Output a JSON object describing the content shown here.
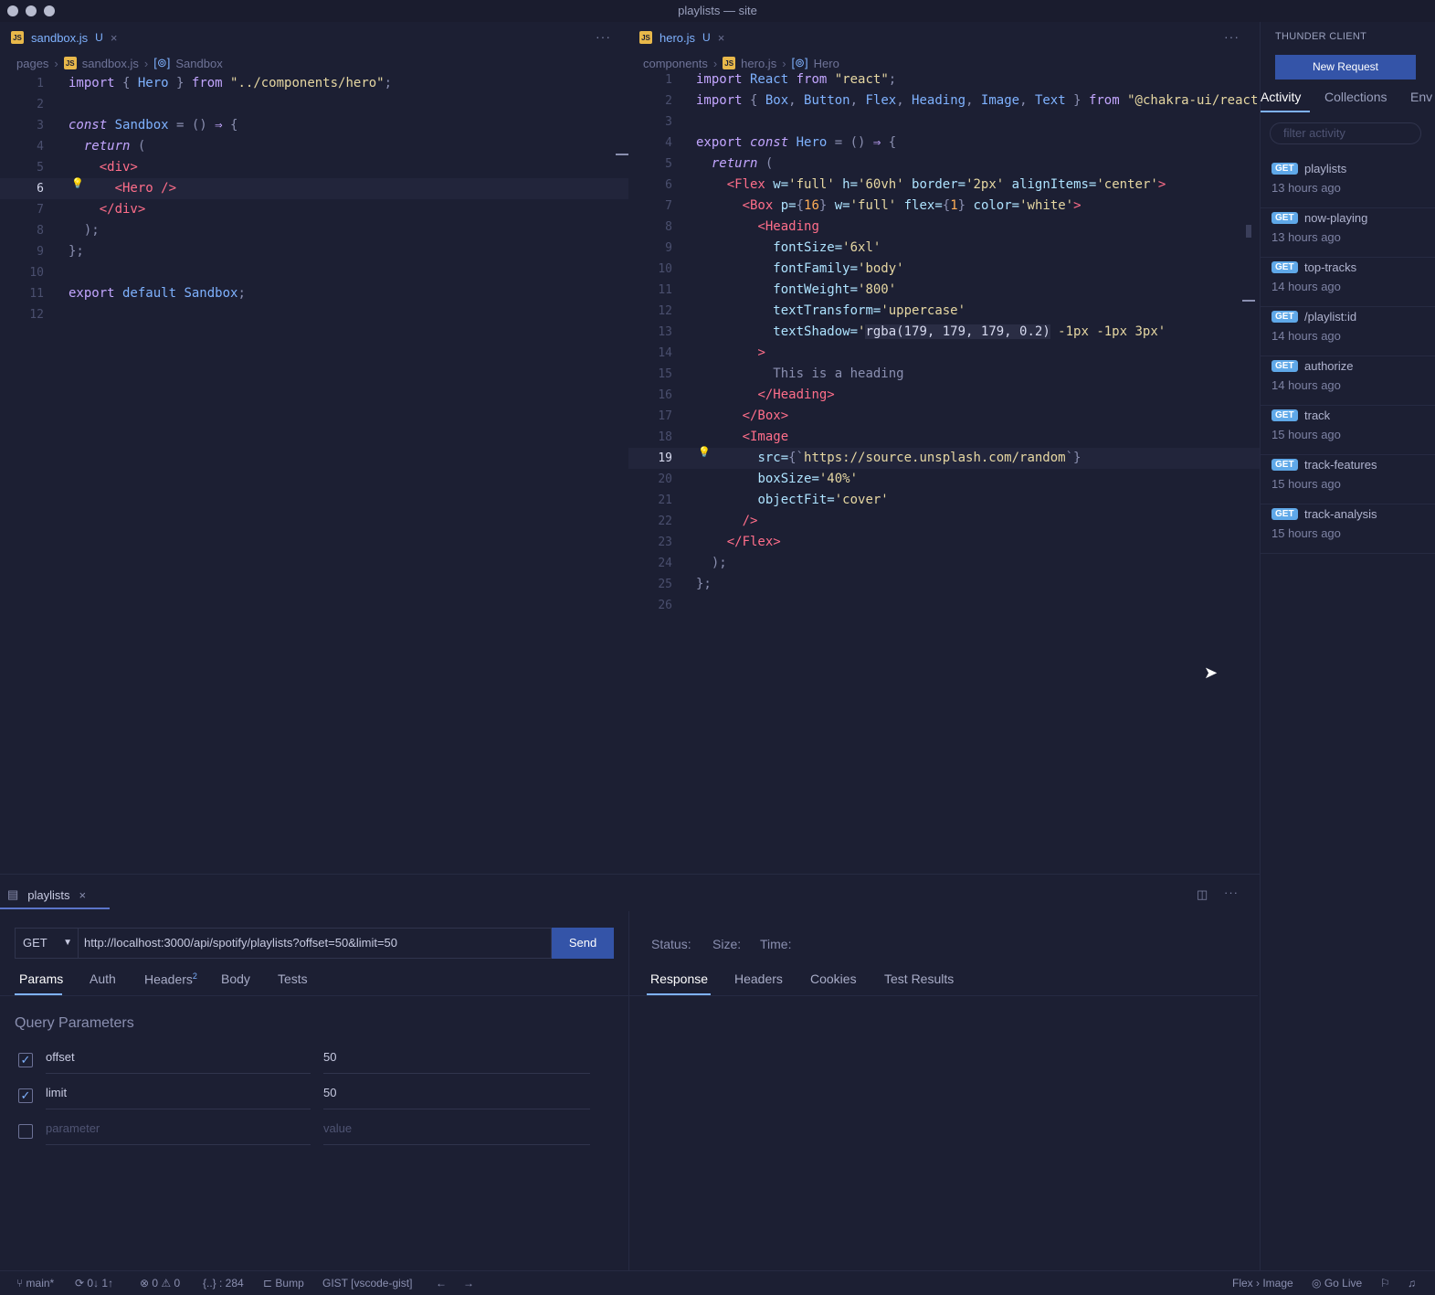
{
  "window": {
    "title": "playlists — site"
  },
  "left_editor": {
    "tab": {
      "filename": "sandbox.js",
      "modified": "U",
      "close": "×",
      "icon": "JS"
    },
    "more": "···",
    "breadcrumb": [
      "pages",
      "sandbox.js",
      "Sandbox"
    ],
    "line_numbers": [
      "1",
      "2",
      "3",
      "4",
      "5",
      "6",
      "7",
      "8",
      "9",
      "10",
      "11",
      "12"
    ],
    "lines": [
      [
        [
          "kw",
          "import"
        ],
        [
          "pn",
          " { "
        ],
        [
          "vr",
          "Hero"
        ],
        [
          "pn",
          " } "
        ],
        [
          "kw",
          "from"
        ],
        [
          "st",
          " \"../components/hero\""
        ],
        [
          "pn",
          ";"
        ]
      ],
      [],
      [
        [
          "it",
          "const"
        ],
        [
          "vr",
          " Sandbox"
        ],
        [
          "pn",
          " = () "
        ],
        [
          "kw",
          "⇒"
        ],
        [
          "pn",
          " {"
        ]
      ],
      [
        [
          "cm",
          "  "
        ],
        [
          "it",
          "return"
        ],
        [
          "pn",
          " ("
        ]
      ],
      [
        [
          "cm",
          "    "
        ],
        [
          "tg",
          "<div>"
        ]
      ],
      [
        [
          "cm",
          "      "
        ],
        [
          "tg",
          "<Hero />"
        ]
      ],
      [
        [
          "cm",
          "    "
        ],
        [
          "tg",
          "</div>"
        ]
      ],
      [
        [
          "cm",
          "  "
        ],
        [
          "pn",
          ");"
        ]
      ],
      [
        [
          "pn",
          "};"
        ]
      ],
      [],
      [
        [
          "kw",
          "export"
        ],
        [
          "vr",
          " default"
        ],
        [
          "vr",
          " Sandbox"
        ],
        [
          "pn",
          ";"
        ]
      ],
      []
    ]
  },
  "right_editor": {
    "tab": {
      "filename": "hero.js",
      "modified": "U",
      "close": "×",
      "icon": "JS"
    },
    "more": "···",
    "breadcrumb": [
      "components",
      "hero.js",
      "Hero"
    ],
    "line_numbers": [
      "1",
      "2",
      "3",
      "4",
      "5",
      "6",
      "7",
      "8",
      "9",
      "10",
      "11",
      "12",
      "13",
      "14",
      "15",
      "16",
      "17",
      "18",
      "19",
      "20",
      "21",
      "22",
      "23",
      "24",
      "25",
      "26"
    ],
    "lines": [
      [
        [
          "kw",
          "import"
        ],
        [
          "vr",
          " React"
        ],
        [
          "kw",
          " from"
        ],
        [
          "st",
          " \"react\""
        ],
        [
          "pn",
          ";"
        ]
      ],
      [
        [
          "kw",
          "import"
        ],
        [
          "pn",
          " { "
        ],
        [
          "vr",
          "Box"
        ],
        [
          "pn",
          ", "
        ],
        [
          "vr",
          "Button"
        ],
        [
          "pn",
          ", "
        ],
        [
          "vr",
          "Flex"
        ],
        [
          "pn",
          ", "
        ],
        [
          "vr",
          "Heading"
        ],
        [
          "pn",
          ", "
        ],
        [
          "vr",
          "Image"
        ],
        [
          "pn",
          ", "
        ],
        [
          "vr",
          "Text"
        ],
        [
          "pn",
          " } "
        ],
        [
          "kw",
          "from"
        ],
        [
          "st",
          " \"@chakra-ui/react"
        ]
      ],
      [],
      [
        [
          "kw",
          "export"
        ],
        [
          "it",
          " const"
        ],
        [
          "vr",
          " Hero"
        ],
        [
          "pn",
          " = () "
        ],
        [
          "kw",
          "⇒"
        ],
        [
          "pn",
          " {"
        ]
      ],
      [
        [
          "cm",
          "  "
        ],
        [
          "it",
          "return"
        ],
        [
          "pn",
          " ("
        ]
      ],
      [
        [
          "cm",
          "    "
        ],
        [
          "tg",
          "<Flex"
        ],
        [
          "at",
          " w="
        ],
        [
          "st",
          "'full'"
        ],
        [
          "at",
          " h="
        ],
        [
          "st",
          "'60vh'"
        ],
        [
          "at",
          " border="
        ],
        [
          "st",
          "'2px'"
        ],
        [
          "at",
          " alignItems="
        ],
        [
          "st",
          "'center'"
        ],
        [
          "tg",
          ">"
        ]
      ],
      [
        [
          "cm",
          "      "
        ],
        [
          "tg",
          "<Box"
        ],
        [
          "at",
          " p="
        ],
        [
          "pn",
          "{"
        ],
        [
          "nm",
          "16"
        ],
        [
          "pn",
          "}"
        ],
        [
          "at",
          " w="
        ],
        [
          "st",
          "'full'"
        ],
        [
          "at",
          " flex="
        ],
        [
          "pn",
          "{"
        ],
        [
          "nm",
          "1"
        ],
        [
          "pn",
          "}"
        ],
        [
          "at",
          " color="
        ],
        [
          "st",
          "'white'"
        ],
        [
          "tg",
          ">"
        ]
      ],
      [
        [
          "cm",
          "        "
        ],
        [
          "tg",
          "<Heading"
        ]
      ],
      [
        [
          "cm",
          "          "
        ],
        [
          "at",
          "fontSize="
        ],
        [
          "st",
          "'6xl'"
        ]
      ],
      [
        [
          "cm",
          "          "
        ],
        [
          "at",
          "fontFamily="
        ],
        [
          "st",
          "'body'"
        ]
      ],
      [
        [
          "cm",
          "          "
        ],
        [
          "at",
          "fontWeight="
        ],
        [
          "st",
          "'800'"
        ]
      ],
      [
        [
          "cm",
          "          "
        ],
        [
          "at",
          "textTransform="
        ],
        [
          "st",
          "'uppercase'"
        ]
      ],
      [
        [
          "cm",
          "          "
        ],
        [
          "at",
          "textShadow="
        ],
        [
          "st",
          "'"
        ],
        [
          "hl",
          "rgba(179, 179, 179, 0.2)"
        ],
        [
          "st",
          " -1px -1px 3px'"
        ]
      ],
      [
        [
          "cm",
          "        "
        ],
        [
          "tg",
          ">"
        ]
      ],
      [
        [
          "cm",
          "          "
        ],
        [
          "pn",
          "This is a heading"
        ]
      ],
      [
        [
          "cm",
          "        "
        ],
        [
          "tg",
          "</Heading>"
        ]
      ],
      [
        [
          "cm",
          "      "
        ],
        [
          "tg",
          "</Box>"
        ]
      ],
      [
        [
          "cm",
          "      "
        ],
        [
          "tg",
          "<Image"
        ]
      ],
      [
        [
          "cm",
          "        "
        ],
        [
          "at",
          "src="
        ],
        [
          "pn",
          "{`"
        ],
        [
          "st",
          "https://source.unsplash.com/random"
        ],
        [
          "pn",
          "`}"
        ]
      ],
      [
        [
          "cm",
          "        "
        ],
        [
          "at",
          "boxSize="
        ],
        [
          "st",
          "'40%'"
        ]
      ],
      [
        [
          "cm",
          "        "
        ],
        [
          "at",
          "objectFit="
        ],
        [
          "st",
          "'cover'"
        ]
      ],
      [
        [
          "cm",
          "      "
        ],
        [
          "tg",
          "/>"
        ]
      ],
      [
        [
          "cm",
          "    "
        ],
        [
          "tg",
          "</Flex>"
        ]
      ],
      [
        [
          "cm",
          "  "
        ],
        [
          "pn",
          ");"
        ]
      ],
      [
        [
          "pn",
          "};"
        ]
      ],
      []
    ]
  },
  "sidebar": {
    "title": "THUNDER CLIENT",
    "new_request": "New Request",
    "tabs": [
      "Activity",
      "Collections",
      "Env"
    ],
    "filter_placeholder": "filter activity",
    "activity": [
      {
        "method": "GET",
        "name": "playlists",
        "time": "13 hours ago"
      },
      {
        "method": "GET",
        "name": "now-playing",
        "time": "13 hours ago"
      },
      {
        "method": "GET",
        "name": "top-tracks",
        "time": "14 hours ago"
      },
      {
        "method": "GET",
        "name": "/playlist:id",
        "time": "14 hours ago"
      },
      {
        "method": "GET",
        "name": "authorize",
        "time": "14 hours ago"
      },
      {
        "method": "GET",
        "name": "track",
        "time": "15 hours ago"
      },
      {
        "method": "GET",
        "name": "track-features",
        "time": "15 hours ago"
      },
      {
        "method": "GET",
        "name": "track-analysis",
        "time": "15 hours ago"
      }
    ]
  },
  "request": {
    "tab_label": "playlists",
    "close": "×",
    "method": "GET",
    "url": "http://localhost:3000/api/spotify/playlists?offset=50&limit=50",
    "send": "Send",
    "tabs": [
      "Params",
      "Auth",
      "Headers",
      "Body",
      "Tests"
    ],
    "headers_count": "2",
    "query_title": "Query Parameters",
    "params": [
      {
        "checked": true,
        "key": "offset",
        "value": "50"
      },
      {
        "checked": true,
        "key": "limit",
        "value": "50"
      }
    ],
    "param_placeholder": "parameter",
    "value_placeholder": "value",
    "status_label": "Status:",
    "size_label": "Size:",
    "time_label": "Time:",
    "response_tabs": [
      "Response",
      "Headers",
      "Cookies",
      "Test Results"
    ]
  },
  "statusbar": {
    "branch": "main*",
    "sync": "0↓ 1↑",
    "problems": "⊗ 0 ⚠ 0",
    "braces": "{..} : 284",
    "bump": "Bump",
    "gist": "GIST [vscode-gist]",
    "back": "←",
    "forward": "→",
    "breadcrumb": "Flex › Image",
    "go_live": "Go Live"
  }
}
